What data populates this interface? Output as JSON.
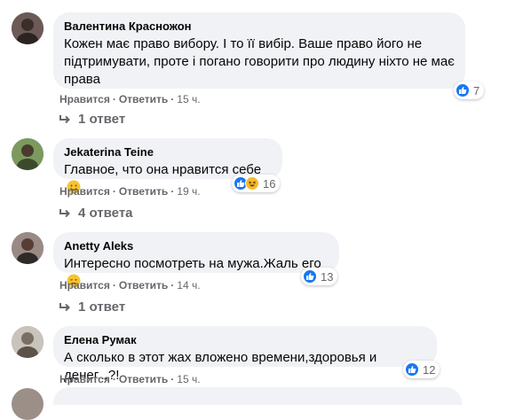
{
  "comments": [
    {
      "author": "Валентина Красножон",
      "text": "Кожен має право вибору. І то її вибір. Ваше право його не підтримувати, проте і погано говорити про людину ніхто не має права",
      "like_label": "Нравится",
      "reply_label": "Ответить",
      "time": "15 ч.",
      "reaction_count": "7",
      "replies_label": "1 ответ"
    },
    {
      "author": "Jekaterina Teine",
      "text": "Главное, что она нравится себе",
      "like_label": "Нравится",
      "reply_label": "Ответить",
      "time": "19 ч.",
      "reaction_count": "16",
      "replies_label": "4 ответа"
    },
    {
      "author": "Anetty Aleks",
      "text": "Интересно посмотреть на мужа.Жаль его",
      "like_label": "Нравится",
      "reply_label": "Ответить",
      "time": "14 ч.",
      "reaction_count": "13",
      "replies_label": "1 ответ"
    },
    {
      "author": "Елена Румак",
      "text": "А сколько в этот жах вложено времени,здоровья и денег...?!",
      "like_label": "Нравится",
      "reply_label": "Ответить",
      "time": "15 ч.",
      "reaction_count": "12"
    }
  ],
  "colors": {
    "bubble": "#f0f2f5",
    "muted_text": "#65676b",
    "like_blue": "#1877f2",
    "haha_yellow": "#f7b928"
  },
  "icons": [
    "like-icon",
    "haha-icon",
    "reply-arrow-icon",
    "smile-emoji-icon",
    "disappointed-emoji-icon"
  ]
}
